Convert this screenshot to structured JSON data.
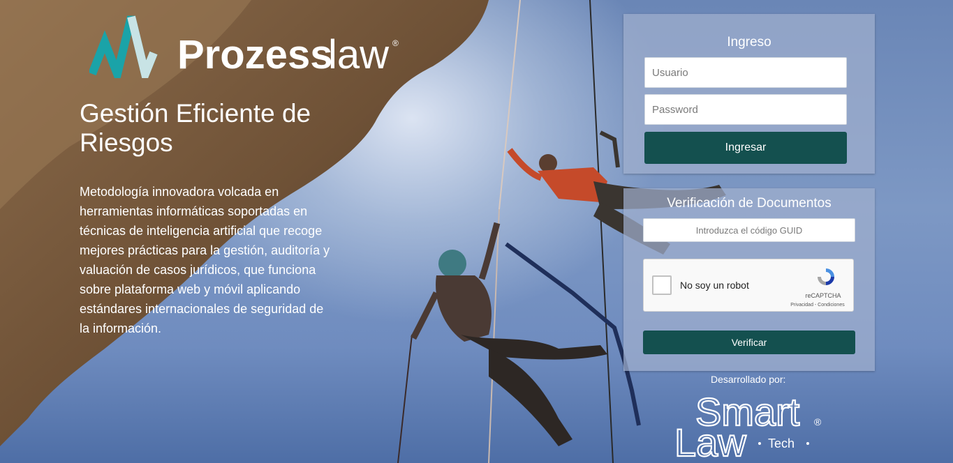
{
  "brand": {
    "name_bold": "Prozess",
    "name_light": "law",
    "registered": "®"
  },
  "hero": {
    "title": "Gestión Eficiente de Riesgos",
    "description": "Metodología innovadora volcada en herramientas informáticas soportadas en técnicas de inteligencia artificial que recoge mejores prácticas para la gestión, auditoría y valuación de casos jurídicos, que funciona sobre plataforma web y móvil aplicando estándares internacionales de seguridad de la información."
  },
  "login": {
    "title": "Ingreso",
    "username_placeholder": "Usuario",
    "password_placeholder": "Password",
    "submit_label": "Ingresar"
  },
  "verification": {
    "title": "Verificación de Documentos",
    "guid_placeholder": "Introduzca el código GUID",
    "captcha_label": "No soy un robot",
    "captcha_brand": "reCAPTCHA",
    "captcha_legal": "Privacidad - Condiciones",
    "submit_label": "Verificar"
  },
  "footer": {
    "developed_by": "Desarrollado por:",
    "dev_logo_line1": "Smart",
    "dev_logo_line2": "Law",
    "dev_logo_suffix": "Tech",
    "dev_logo_registered": "®"
  },
  "colors": {
    "primary_button": "#14504f",
    "logo_teal": "#1aa3a8",
    "panel_bg": "rgba(160,175,205,0.72)"
  },
  "icons": [
    "prozess-logo-icon",
    "recaptcha-icon",
    "checkbox-icon"
  ]
}
